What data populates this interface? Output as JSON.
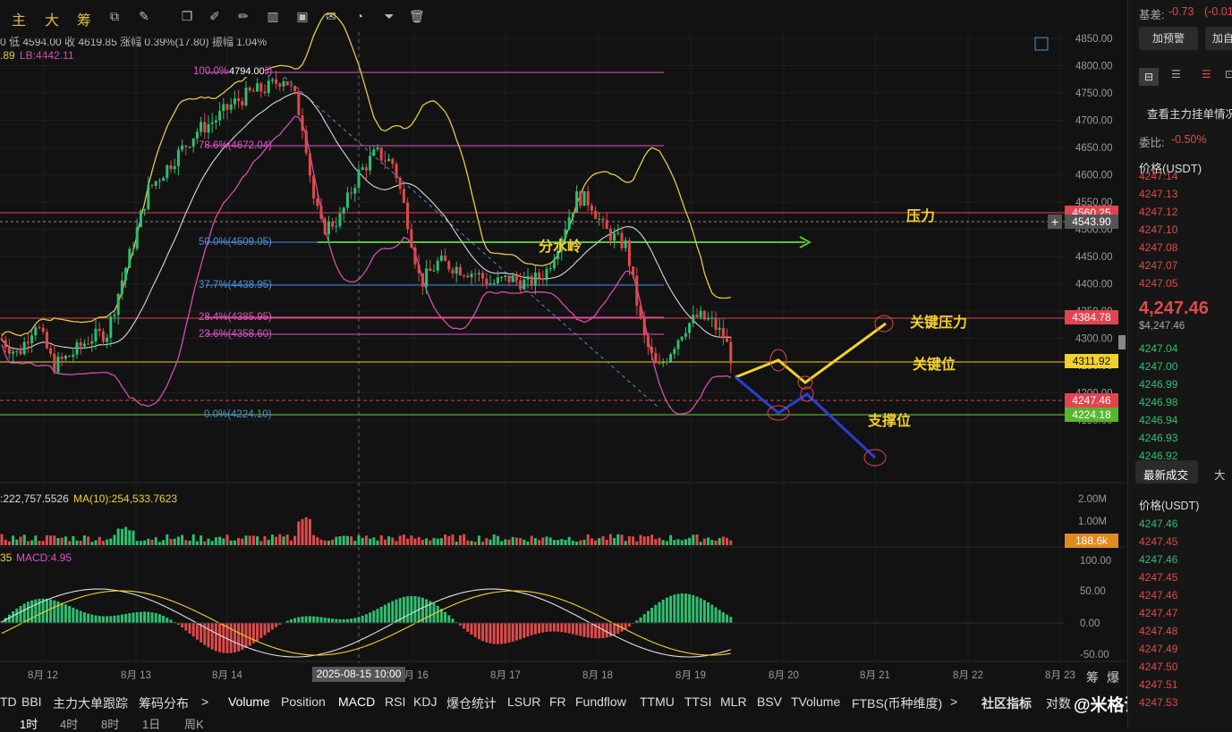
{
  "toolbar": {
    "brand": [
      "主",
      "大",
      "筹"
    ],
    "icons": [
      "sync-icon",
      "magic-icon",
      "copy-icon",
      "ruler-icon",
      "brush-icon",
      "bars-icon",
      "lock-icon",
      "note-icon",
      "magnet-icon",
      "filter-icon",
      "trash-icon"
    ]
  },
  "ohlc": {
    "line1_pre": "0 低 4594.00 收 4619.85 涨幅 0.39%(17.80) 振幅 1.04%",
    "line2_a": ".89",
    "line2_b": "LB:4442.11"
  },
  "fib": {
    "f100": "100.0%(4794.00)",
    "f786": "78.6%(4672.04)",
    "f50": "50.0%(4509.05)",
    "f377": "37.7%(4438.95)",
    "f284": "28.4%(4385.95)",
    "f236": "23.6%(4358.60)",
    "f0": "0.0%(4224.10)",
    "top_label": "4794.00"
  },
  "price_axis": [
    "4850.00",
    "4800.00",
    "4750.00",
    "4700.00",
    "4650.00",
    "4600.00",
    "4550.00",
    "4500.00",
    "4450.00",
    "4400.00",
    "4350.00",
    "4300.00",
    "4250.00",
    "4200.00",
    "4150.00"
  ],
  "price_tags": {
    "p4560": "4560.25",
    "crosshair": "4543.90",
    "p4384": "4384.78",
    "p4311": "4311.92",
    "last": "4247.46",
    "p4224": "4224.18"
  },
  "annotations": {
    "pressure": "压力",
    "watershed": "分水岭",
    "key_pressure": "关键压力",
    "key_level": "关键位",
    "support": "支撑位"
  },
  "volume": {
    "legend_a": ":222,757.5526",
    "legend_b": "MA(10):254,533.7623",
    "axis": [
      "2.00M",
      "1.00M"
    ],
    "tag": "188.6k"
  },
  "macd": {
    "legend_a": "35",
    "legend_b": "MACD:4.95",
    "axis": [
      "100.00",
      "50.00",
      "0.00",
      "-50.00"
    ]
  },
  "date_axis": [
    "8月 12",
    "8月 13",
    "8月 14",
    "8月 16",
    "8月 17",
    "8月 18",
    "8月 19",
    "8月 20",
    "8月 21",
    "8月 22",
    "8月 23"
  ],
  "crosshair_date": "2025-08-15 10:00",
  "date_axis_right": [
    "筹",
    "爆"
  ],
  "indicator_tabs": [
    "TD",
    "BBI",
    "主力大单跟踪",
    "筹码分布",
    ">",
    "Volume",
    "Position",
    "MACD",
    "RSI",
    "KDJ",
    "爆仓统计",
    "LSUR",
    "FR",
    "Fundflow",
    "TTMU",
    "TTSI",
    "MLR",
    "BSV",
    "TVolume",
    "FTBS(币种维度)",
    ">",
    "社区指标",
    "对数"
  ],
  "interval_tabs": [
    "1时",
    "4时",
    "8时",
    "1日",
    "周K"
  ],
  "watermark": "@米格说趋势",
  "right_panel": {
    "basis_label": "基差:",
    "basis_value": "-0.73",
    "basis_pct": "(-0.01",
    "btn_alert": "加预警",
    "btn_add": "加自",
    "order_book_link": "查看主力挂单情况",
    "commission_label": "委比:",
    "commission_value": "-0.50%",
    "price_header": "价格(USDT)",
    "asks": [
      "4247.14",
      "4247.13",
      "4247.12",
      "4247.10",
      "4247.08",
      "4247.07",
      "4247.05"
    ],
    "last_price": "4,247.46",
    "last_price_sub": "$4,247.46",
    "bids": [
      "4247.04",
      "4247.00",
      "4246.99",
      "4246.98",
      "4246.94",
      "4246.93",
      "4246.92"
    ],
    "tabs": [
      "最新成交",
      "大"
    ],
    "trades_header": "价格(USDT)",
    "trades": [
      {
        "p": "4247.46",
        "c": "grn"
      },
      {
        "p": "4247.45",
        "c": "red"
      },
      {
        "p": "4247.46",
        "c": "grn"
      },
      {
        "p": "4247.45",
        "c": "red"
      },
      {
        "p": "4247.46",
        "c": "red"
      },
      {
        "p": "4247.47",
        "c": "red"
      },
      {
        "p": "4247.48",
        "c": "red"
      },
      {
        "p": "4247.49",
        "c": "red"
      },
      {
        "p": "4247.50",
        "c": "red"
      },
      {
        "p": "4247.51",
        "c": "red"
      },
      {
        "p": "4247.53",
        "c": "red"
      }
    ]
  },
  "colors": {
    "up": "#2fbf71",
    "down": "#e04a4a",
    "accent": "#f2d12c"
  }
}
